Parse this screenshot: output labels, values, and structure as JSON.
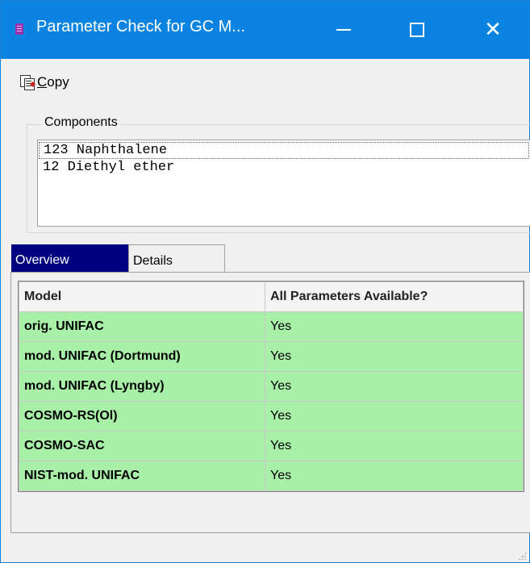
{
  "window": {
    "title": "Parameter Check for GC M...",
    "controls": {
      "minimize": "—",
      "maximize": "☐",
      "close": "✕"
    }
  },
  "toolbar": {
    "copy_label_underlined": "C",
    "copy_label_rest": "opy",
    "copy_icon": "copy-icon"
  },
  "components": {
    "legend": "Components",
    "items": [
      "123 Naphthalene",
      "12 Diethyl ether"
    ]
  },
  "tabs": [
    {
      "label": "Overview",
      "active": true
    },
    {
      "label": "Details",
      "active": false
    }
  ],
  "table": {
    "headers": [
      "Model",
      "All Parameters Available?"
    ],
    "rows": [
      {
        "model": "orig. UNIFAC",
        "available": "Yes"
      },
      {
        "model": "mod. UNIFAC (Dortmund)",
        "available": "Yes"
      },
      {
        "model": "mod. UNIFAC (Lyngby)",
        "available": "Yes"
      },
      {
        "model": "COSMO-RS(Ol)",
        "available": "Yes"
      },
      {
        "model": "COSMO-SAC",
        "available": "Yes"
      },
      {
        "model": "NIST-mod. UNIFAC",
        "available": "Yes"
      }
    ]
  },
  "colors": {
    "titlebar": "#0a84e0",
    "active_tab": "#000080",
    "available_cell": "#a8f0a8"
  }
}
